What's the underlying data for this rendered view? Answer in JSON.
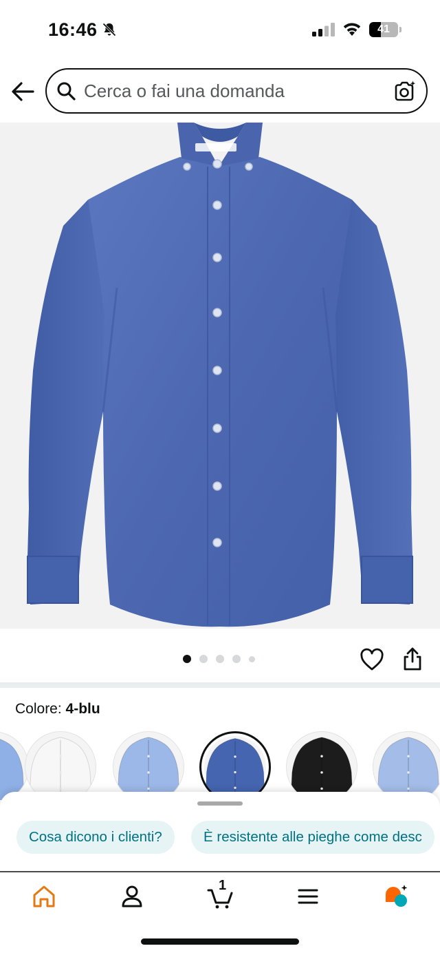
{
  "status_bar": {
    "time": "16:46",
    "battery": "41",
    "battery_percent": 41,
    "icons": [
      "bell-slash-icon",
      "signal-icon",
      "wifi-icon",
      "battery-icon"
    ]
  },
  "search": {
    "placeholder": "Cerca o fai una domanda",
    "icons": [
      "back-arrow-icon",
      "search-icon",
      "camera-search-icon"
    ]
  },
  "product": {
    "image_name": "blue-button-down-shirt",
    "gallery_dots": 5,
    "active_dot": 1,
    "actions": [
      "heart-icon",
      "share-icon"
    ]
  },
  "variant": {
    "label": "Colore:",
    "value": "4-blu",
    "swatches": [
      {
        "color": "#8fb0e6"
      },
      {
        "color": "#f7f7f7"
      },
      {
        "color": "#9cb8e8"
      },
      {
        "color": "#4565b0",
        "selected": true
      },
      {
        "color": "#1c1c1c"
      },
      {
        "color": "#a3bde8"
      }
    ]
  },
  "sheet": {
    "chips": [
      "Cosa dicono i clienti?",
      "È resistente alle pieghe come desc"
    ]
  },
  "nav": {
    "cart_count": "1",
    "items": [
      "home-icon",
      "account-icon",
      "cart-icon",
      "menu-icon",
      "rufus-assistant-icon"
    ],
    "colors": {
      "active": "#e47911",
      "assistant_a": "#ff6600",
      "assistant_b": "#00a8b5"
    }
  },
  "colors": {
    "chip_bg": "#e6f4f5",
    "chip_text": "#007185",
    "shirt": "#4d68b0"
  }
}
